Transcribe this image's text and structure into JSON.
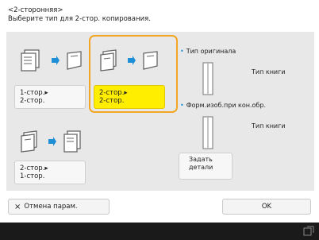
{
  "header": {
    "title": "<2-сторонняя>",
    "subtitle": "Выберите тип для 2-стор. копирования."
  },
  "options": [
    {
      "label": "1-стор.▸\n2-стор.",
      "icon_left": "one-sided-doc-icon",
      "icon_right": "two-sided-page-icon"
    },
    {
      "label": "2-стор.▸\n2-стор.",
      "icon_left": "two-sided-doc-icon",
      "icon_right": "two-sided-page-icon",
      "selected": true
    },
    {
      "label": "2-стор.▸\n1-стор.",
      "icon_left": "two-sided-doc-icon",
      "icon_right": "one-sided-doc-icon"
    }
  ],
  "original_type": {
    "label": "Тип оригинала",
    "value": "Тип книги"
  },
  "finishing": {
    "label": "Форм.изоб.при кон.обр.",
    "value": "Тип книги"
  },
  "details_button": "Задать\nдетали",
  "cancel_button": "Отмена парам.",
  "ok_button": "OK",
  "colors": {
    "accent": "#1e8fd6",
    "selected": "#ffee00",
    "selection_outline": "#f2a623"
  }
}
